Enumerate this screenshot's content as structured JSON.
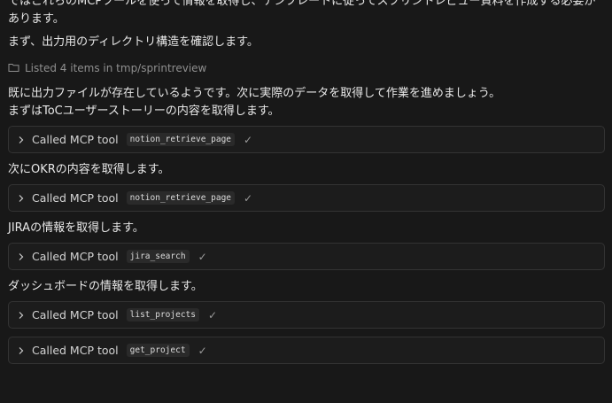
{
  "messages": {
    "cut_line1": "ではこれらのMCPツールを使って情報を取得し、テンプレートに従ってスプリントレビュー資料を作成する必要が",
    "cut_line2": "あります。",
    "check_dir": "まず、出力用のディレクトリ構造を確認します。",
    "listed": "Listed 4 items in tmp/sprintreview",
    "exists": "既に出力ファイルが存在しているようです。次に実際のデータを取得して作業を進めましょう。",
    "toc": "まずはToCユーザーストーリーの内容を取得します。",
    "okr": "次にOKRの内容を取得します。",
    "jira": "JIRAの情報を取得します。",
    "dashboard": "ダッシュボードの情報を取得します。"
  },
  "tool_calls": [
    {
      "label": "Called MCP tool",
      "name": "notion_retrieve_page"
    },
    {
      "label": "Called MCP tool",
      "name": "notion_retrieve_page"
    },
    {
      "label": "Called MCP tool",
      "name": "jira_search"
    },
    {
      "label": "Called MCP tool",
      "name": "list_projects"
    },
    {
      "label": "Called MCP tool",
      "name": "get_project"
    }
  ],
  "icons": {
    "folder": "folder-icon",
    "chevron": "chevron-right-icon",
    "check": "checkmark-icon"
  }
}
